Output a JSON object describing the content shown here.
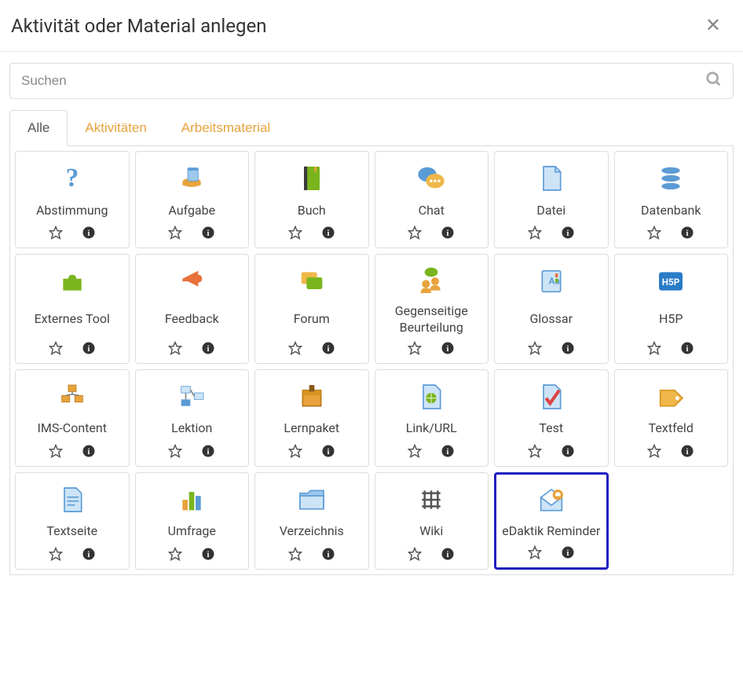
{
  "header": {
    "title": "Aktivität oder Material anlegen"
  },
  "search": {
    "placeholder": "Suchen"
  },
  "tabs": [
    {
      "label": "Alle",
      "active": true
    },
    {
      "label": "Aktivitäten",
      "active": false
    },
    {
      "label": "Arbeitsmaterial",
      "active": false
    }
  ],
  "items": [
    {
      "label": "Abstimmung",
      "icon": "question",
      "highlighted": false
    },
    {
      "label": "Aufgabe",
      "icon": "assignment",
      "highlighted": false
    },
    {
      "label": "Buch",
      "icon": "book",
      "highlighted": false
    },
    {
      "label": "Chat",
      "icon": "chat",
      "highlighted": false
    },
    {
      "label": "Datei",
      "icon": "file",
      "highlighted": false
    },
    {
      "label": "Datenbank",
      "icon": "database",
      "highlighted": false
    },
    {
      "label": "Externes Tool",
      "icon": "puzzle",
      "highlighted": false
    },
    {
      "label": "Feedback",
      "icon": "megaphone",
      "highlighted": false
    },
    {
      "label": "Forum",
      "icon": "forum",
      "highlighted": false
    },
    {
      "label": "Gegenseitige Beurteilung",
      "icon": "peer",
      "highlighted": false
    },
    {
      "label": "Glossar",
      "icon": "glossary",
      "highlighted": false
    },
    {
      "label": "H5P",
      "icon": "h5p",
      "highlighted": false
    },
    {
      "label": "IMS-Content",
      "icon": "ims",
      "highlighted": false
    },
    {
      "label": "Lektion",
      "icon": "lesson",
      "highlighted": false
    },
    {
      "label": "Lernpaket",
      "icon": "scorm",
      "highlighted": false
    },
    {
      "label": "Link/URL",
      "icon": "url",
      "highlighted": false
    },
    {
      "label": "Test",
      "icon": "quiz",
      "highlighted": false
    },
    {
      "label": "Textfeld",
      "icon": "label",
      "highlighted": false
    },
    {
      "label": "Textseite",
      "icon": "page",
      "highlighted": false
    },
    {
      "label": "Umfrage",
      "icon": "survey",
      "highlighted": false
    },
    {
      "label": "Verzeichnis",
      "icon": "folder",
      "highlighted": false
    },
    {
      "label": "Wiki",
      "icon": "wiki",
      "highlighted": false
    },
    {
      "label": "eDaktik Reminder",
      "icon": "reminder",
      "highlighted": true
    }
  ]
}
